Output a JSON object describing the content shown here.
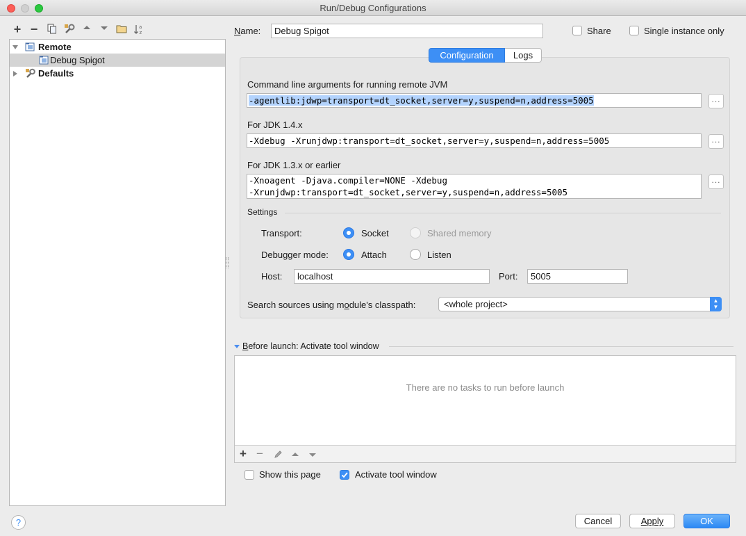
{
  "window": {
    "title": "Run/Debug Configurations"
  },
  "colors": {
    "accent": "#3d8ff5",
    "selection": "#b3d3fd",
    "selected_row": "#d4d4d4"
  },
  "toolbar": {
    "icons": [
      "add-icon",
      "remove-icon",
      "copy-icon",
      "wrench-icon",
      "move-up-icon",
      "move-down-icon",
      "folder-icon",
      "sort-az-icon"
    ],
    "add_label": "+",
    "remove_label": "−"
  },
  "tree": {
    "remote_label": "Remote",
    "debug_spigot_label": "Debug Spigot",
    "defaults_label": "Defaults"
  },
  "header": {
    "name_label_prefix": "N",
    "name_label_rest": "ame:",
    "name_value": "Debug Spigot",
    "share_label": "Share",
    "single_instance_label": "Single instance only",
    "share_checked": false,
    "single_instance_checked": false
  },
  "tabs": {
    "configuration": "Configuration",
    "logs": "Logs",
    "active": "Configuration"
  },
  "config": {
    "cmd_label": "Command line arguments for running remote JVM",
    "cmd_value": "-agentlib:jdwp=transport=dt_socket,server=y,suspend=n,address=5005",
    "jdk14_label": "For JDK 1.4.x",
    "jdk14_value": "-Xdebug -Xrunjdwp:transport=dt_socket,server=y,suspend=n,address=5005",
    "jdk13_label": "For JDK 1.3.x or earlier",
    "jdk13_line1": "-Xnoagent -Djava.compiler=NONE -Xdebug",
    "jdk13_line2": "-Xrunjdwp:transport=dt_socket,server=y,suspend=n,address=5005",
    "dots": "...",
    "settings_label": "Settings",
    "transport_label": "Transport:",
    "transport_socket": "Socket",
    "transport_shared": "Shared memory",
    "transport_selected": "Socket",
    "debugger_mode_label": "Debugger mode:",
    "mode_attach": "Attach",
    "mode_listen": "Listen",
    "mode_selected": "Attach",
    "host_label": "Host:",
    "host_value": "localhost",
    "port_label": "Port:",
    "port_value": "5005",
    "search_sources_label_a": "Search sources using m",
    "search_sources_label_b": "o",
    "search_sources_label_c": "dule's classpath:",
    "search_sources_value": "<whole project>"
  },
  "before_launch": {
    "title_b": "B",
    "title_rest": "efore launch: Activate tool window",
    "empty_text": "There are no tasks to run before launch",
    "show_page_label": "Show this page",
    "show_page_checked": false,
    "activate_label": "Activate tool window",
    "activate_checked": true
  },
  "footer": {
    "help_label": "?",
    "cancel_label": "Cancel",
    "apply_label": "Apply",
    "ok_label": "OK"
  }
}
